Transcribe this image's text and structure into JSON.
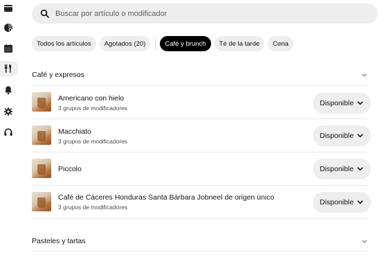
{
  "search": {
    "placeholder": "Buscar por artículo o modificador"
  },
  "sidebar": {
    "icons": [
      "store-icon",
      "reports-icon",
      "calendar-icon",
      "menu-utensils-icon",
      "notifications-bell-icon",
      "settings-gear-icon",
      "support-headset-icon"
    ],
    "active": "menu-utensils-icon"
  },
  "filters": [
    {
      "label": "Todos los artículos",
      "active": false
    },
    {
      "label": "Agotados (20)",
      "active": false
    },
    {
      "label": "Café y brunch",
      "active": true
    },
    {
      "label": "Té de la tarde",
      "active": false
    },
    {
      "label": "Cena",
      "active": false
    }
  ],
  "sections": [
    {
      "title": "Café y expresos"
    },
    {
      "title": "Pasteles y tartas"
    }
  ],
  "items": [
    {
      "name": "Americano con hielo",
      "modifiers": "3 grupos de modificadores",
      "status": "Disponible"
    },
    {
      "name": "Macchiato",
      "modifiers": "3 grupos de modificadores",
      "status": "Disponible"
    },
    {
      "name": "Piccolo",
      "modifiers": "",
      "status": "Disponible"
    },
    {
      "name": "Café de Cáceres Honduras Santa Bárbara Jobneel de origen único",
      "modifiers": "3 grupos de modificadores",
      "status": "Disponible"
    }
  ],
  "colors": {
    "chip_bg": "#eeeeee",
    "chip_active_bg": "#000000",
    "text": "#111111",
    "divider": "#e8e8e8"
  }
}
